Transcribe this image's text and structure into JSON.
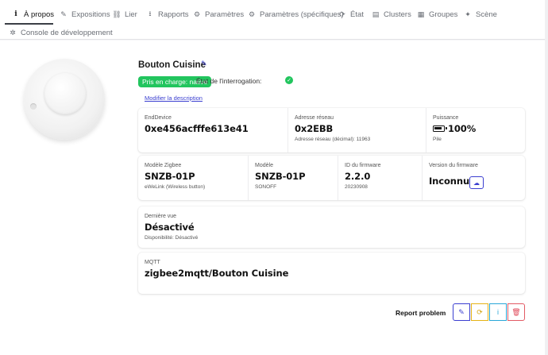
{
  "tabs": [
    {
      "icon": "info-icon",
      "glyph": "i",
      "label": "À propos",
      "active": true
    },
    {
      "icon": "pencil-icon",
      "glyph": "✎",
      "label": "Expositions"
    },
    {
      "icon": "link-icon",
      "glyph": "⛓",
      "label": "Lier"
    },
    {
      "icon": "download-icon",
      "glyph": "⭳",
      "label": "Rapports"
    },
    {
      "icon": "cogs-icon",
      "glyph": "⚙",
      "label": "Paramètres"
    },
    {
      "icon": "cog-icon",
      "glyph": "⚙",
      "label": "Paramètres (spécifiques)"
    },
    {
      "icon": "sync-icon",
      "glyph": "⟳",
      "label": "État"
    },
    {
      "icon": "server-icon",
      "glyph": "▤",
      "label": "Clusters"
    },
    {
      "icon": "group-icon",
      "glyph": "▦",
      "label": "Groupes"
    },
    {
      "icon": "magic-icon",
      "glyph": "✦",
      "label": "Scène"
    },
    {
      "icon": "bug-icon",
      "glyph": "✲",
      "label": "Console de développement"
    }
  ],
  "device": {
    "title": "Bouton Cuisine",
    "support_badge": "Pris en charge: native",
    "support_color": "#22c55e",
    "poll_label": "État de l'interrogation:",
    "poll_ok": "✓",
    "description_link": "Modifier la description",
    "edit_glyph": "✎"
  },
  "card1": {
    "endevice": {
      "label": "EndDevice",
      "value": "0xe456acfffe613e41"
    },
    "network": {
      "label": "Adresse réseau",
      "value": "0x2EBB",
      "sub": "Adresse réseau (décimal): 11963"
    },
    "power": {
      "label": "Puissance",
      "value": "100%",
      "sub": "Pile",
      "icon": "battery-full-icon"
    }
  },
  "card2": {
    "zigbee_model": {
      "label": "Modèle Zigbee",
      "value": "SNZB-01P",
      "sub": "eWeLink (Wireless button)"
    },
    "model": {
      "label": "Modèle",
      "value": "SNZB-01P",
      "sub": "SONOFF"
    },
    "firmware_id": {
      "label": "ID du firmware",
      "value": "2.2.0",
      "sub": "20230908"
    },
    "firmware_version": {
      "label": "Version du firmware",
      "value": "Inconnu",
      "upload_icon": "cloud-upload-icon",
      "upload_glyph": "☁"
    }
  },
  "card3": {
    "label": "Dernière vue",
    "value": "Désactivé",
    "sub": "Disponibilité: Désactivé"
  },
  "card4": {
    "label": "MQTT",
    "value": "zigbee2mqtt/Bouton Cuisine"
  },
  "actions": {
    "report_label": "Report problem",
    "edit_glyph": "✎",
    "reconfigure_glyph": "⟳",
    "info_glyph": "i",
    "delete_glyph": "🗑"
  },
  "colors": {
    "accent": "#3b3fd0",
    "success": "#22c55e",
    "warning": "#e5b316",
    "info": "#2aa7d8",
    "danger": "#e25a64"
  }
}
